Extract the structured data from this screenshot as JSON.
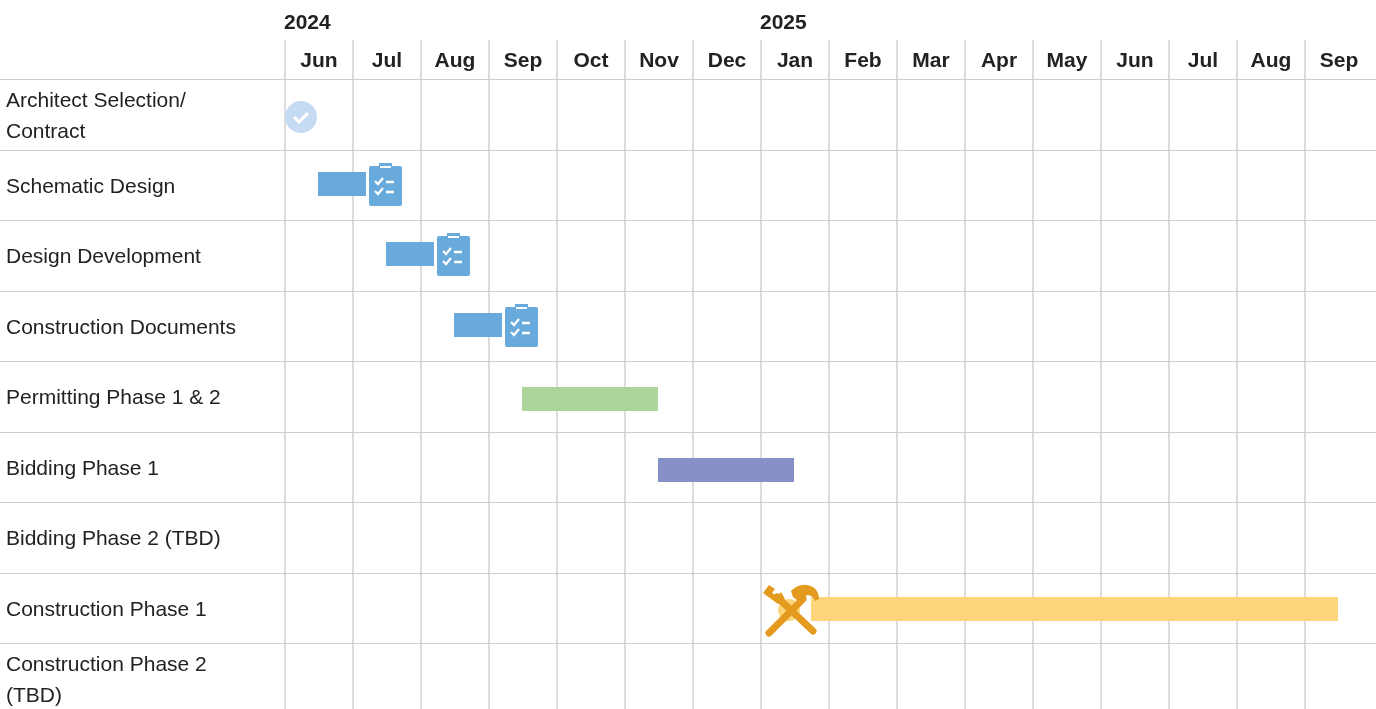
{
  "timeline": {
    "years": [
      "2024",
      "2025"
    ],
    "months": [
      "Jun",
      "Jul",
      "Aug",
      "Sep",
      "Oct",
      "Nov",
      "Dec",
      "Jan",
      "Feb",
      "Mar",
      "Apr",
      "May",
      "Jun",
      "Jul",
      "Aug",
      "Sep"
    ],
    "tasks": [
      {
        "label": "Architect Selection/ Contract",
        "kind": "milestone",
        "color": "#c5dbf2"
      },
      {
        "label": "Schematic Design",
        "kind": "design",
        "color": "#67aadb"
      },
      {
        "label": "Design Development",
        "kind": "design",
        "color": "#67aadb"
      },
      {
        "label": "Construction Documents",
        "kind": "design",
        "color": "#67aadb"
      },
      {
        "label": "Permitting Phase 1 & 2",
        "kind": "bar",
        "color": "#add59b"
      },
      {
        "label": "Bidding Phase 1",
        "kind": "bar",
        "color": "#8591c6"
      },
      {
        "label": "Bidding Phase 2 (TBD)",
        "kind": "none"
      },
      {
        "label": "Construction Phase 1",
        "kind": "construction",
        "color": "#fdd67b"
      },
      {
        "label": "Construction Phase 2 (TBD)",
        "kind": "none"
      }
    ]
  }
}
